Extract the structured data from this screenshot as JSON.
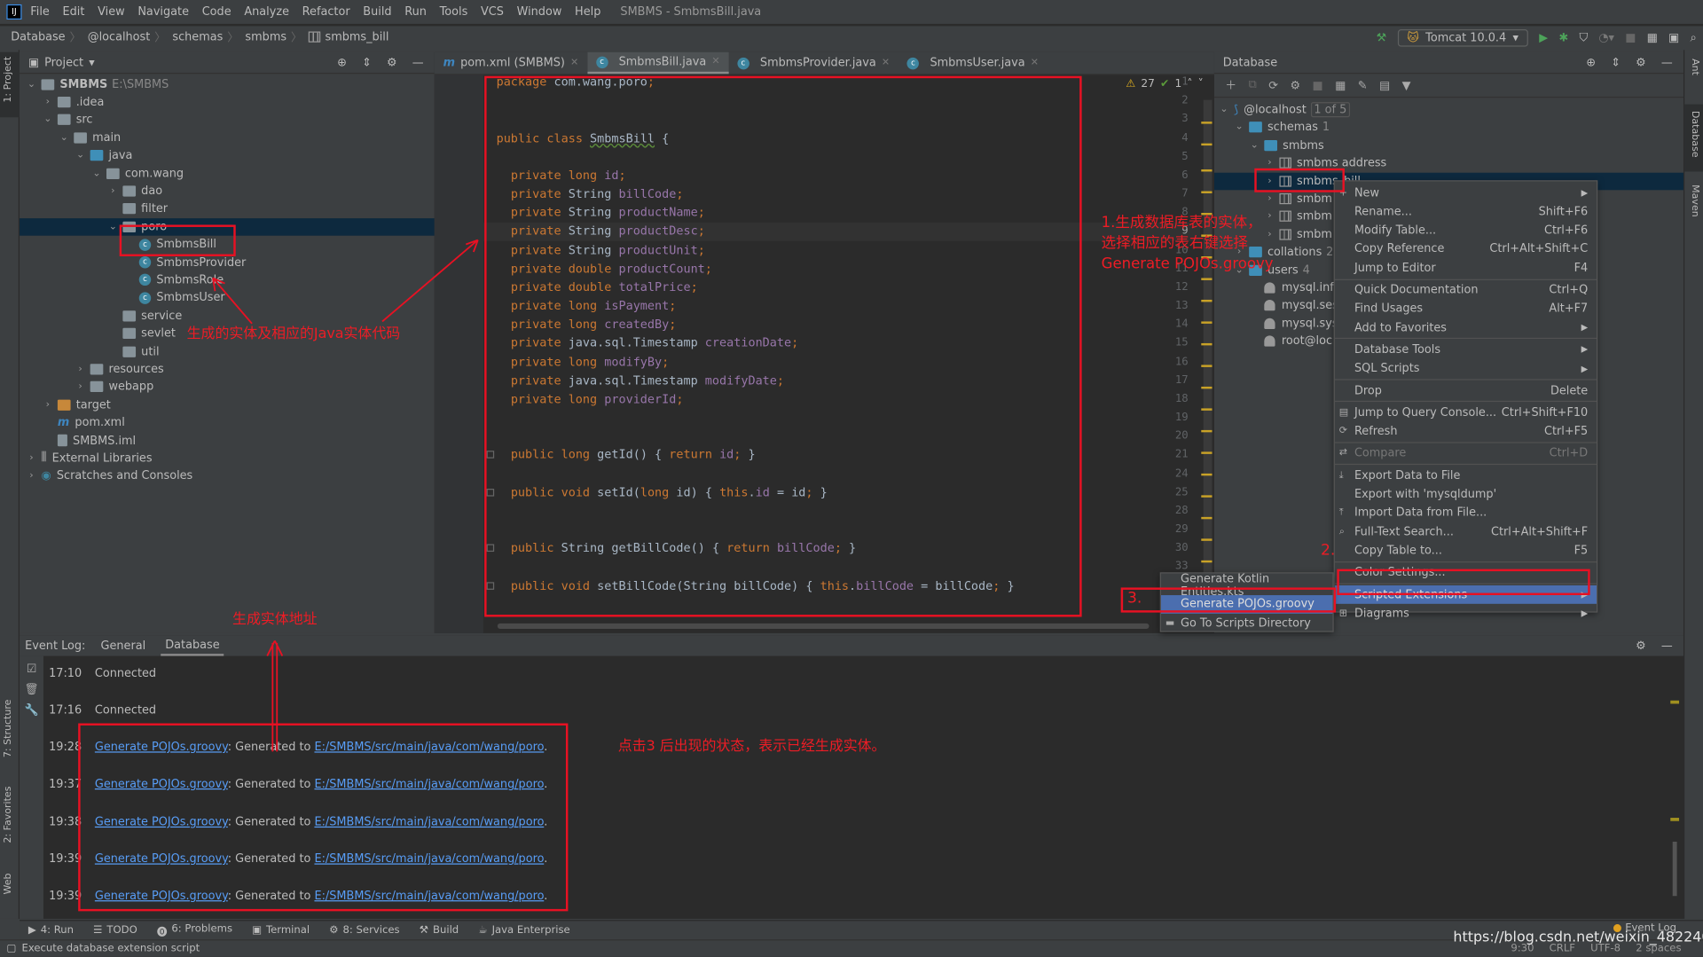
{
  "menubar": {
    "items": [
      "File",
      "Edit",
      "View",
      "Navigate",
      "Code",
      "Analyze",
      "Refactor",
      "Build",
      "Run",
      "Tools",
      "VCS",
      "Window",
      "Help"
    ],
    "title": "SMBMS - SmbmsBill.java"
  },
  "breadcrumb": [
    "Database",
    "@localhost",
    "schemas",
    "smbms",
    "smbms_bill"
  ],
  "run_config": "Tomcat 10.0.4",
  "left_strip": [
    "1: Project",
    "7: Structure",
    "2: Favorites",
    "Web"
  ],
  "right_strip": [
    "Ant",
    "Database",
    "Maven"
  ],
  "project": {
    "title": "Project",
    "tree": [
      {
        "label": "SMBMS",
        "extra": "E:\\SMBMS",
        "depth": 0,
        "open": true,
        "icon": "module"
      },
      {
        "label": ".idea",
        "depth": 1,
        "open": false,
        "icon": "folder"
      },
      {
        "label": "src",
        "depth": 1,
        "open": true,
        "icon": "folder"
      },
      {
        "label": "main",
        "depth": 2,
        "open": true,
        "icon": "folder"
      },
      {
        "label": "java",
        "depth": 3,
        "open": true,
        "icon": "folder-blue"
      },
      {
        "label": "com.wang",
        "depth": 4,
        "open": true,
        "icon": "folder"
      },
      {
        "label": "dao",
        "depth": 5,
        "open": false,
        "icon": "folder"
      },
      {
        "label": "filter",
        "depth": 5,
        "icon": "folder"
      },
      {
        "label": "poro",
        "depth": 5,
        "open": true,
        "icon": "folder",
        "selected": true
      },
      {
        "label": "SmbmsBill",
        "depth": 6,
        "icon": "class"
      },
      {
        "label": "SmbmsProvider",
        "depth": 6,
        "icon": "class"
      },
      {
        "label": "SmbmsRole",
        "depth": 6,
        "icon": "class"
      },
      {
        "label": "SmbmsUser",
        "depth": 6,
        "icon": "class"
      },
      {
        "label": "service",
        "depth": 5,
        "icon": "folder"
      },
      {
        "label": "sevlet",
        "depth": 5,
        "icon": "folder"
      },
      {
        "label": "util",
        "depth": 5,
        "icon": "folder"
      },
      {
        "label": "resources",
        "depth": 3,
        "open": false,
        "icon": "folder"
      },
      {
        "label": "webapp",
        "depth": 3,
        "open": false,
        "icon": "folder"
      },
      {
        "label": "target",
        "depth": 1,
        "open": false,
        "icon": "folder-orange"
      },
      {
        "label": "pom.xml",
        "depth": 1,
        "icon": "maven"
      },
      {
        "label": "SMBMS.iml",
        "depth": 1,
        "icon": "file"
      },
      {
        "label": "External Libraries",
        "depth": 0,
        "open": false,
        "icon": "library"
      },
      {
        "label": "Scratches and Consoles",
        "depth": 0,
        "open": false,
        "icon": "scratch"
      }
    ]
  },
  "editor": {
    "tabs": [
      {
        "label": "pom.xml (SMBMS)",
        "icon": "maven"
      },
      {
        "label": "SmbmsBill.java",
        "icon": "class",
        "active": true
      },
      {
        "label": "SmbmsProvider.java",
        "icon": "class"
      },
      {
        "label": "SmbmsUser.java",
        "icon": "class"
      }
    ],
    "warnings": "27",
    "ok": "1",
    "current_line": 9,
    "lines": [
      {
        "n": "1",
        "t": "package com.wang.poro;"
      },
      {
        "n": "2",
        "t": ""
      },
      {
        "n": "3",
        "t": ""
      },
      {
        "n": "4",
        "t": "public class SmbmsBill {"
      },
      {
        "n": "5",
        "t": ""
      },
      {
        "n": "6",
        "t": "  private long id;"
      },
      {
        "n": "7",
        "t": "  private String billCode;"
      },
      {
        "n": "8",
        "t": "  private String productName;"
      },
      {
        "n": "9",
        "t": "  private String productDesc;"
      },
      {
        "n": "10",
        "t": "  private String productUnit;"
      },
      {
        "n": "11",
        "t": "  private double productCount;"
      },
      {
        "n": "12",
        "t": "  private double totalPrice;"
      },
      {
        "n": "13",
        "t": "  private long isPayment;"
      },
      {
        "n": "14",
        "t": "  private long createdBy;"
      },
      {
        "n": "15",
        "t": "  private java.sql.Timestamp creationDate;"
      },
      {
        "n": "16",
        "t": "  private long modifyBy;"
      },
      {
        "n": "17",
        "t": "  private java.sql.Timestamp modifyDate;"
      },
      {
        "n": "18",
        "t": "  private long providerId;"
      },
      {
        "n": "19",
        "t": ""
      },
      {
        "n": "20",
        "t": ""
      },
      {
        "n": "21",
        "t": "  public long getId() { return id; }"
      },
      {
        "n": "24",
        "t": ""
      },
      {
        "n": "25",
        "t": "  public void setId(long id) { this.id = id; }"
      },
      {
        "n": "28",
        "t": ""
      },
      {
        "n": "29",
        "t": ""
      },
      {
        "n": "30",
        "t": "  public String getBillCode() { return billCode; }"
      },
      {
        "n": "33",
        "t": ""
      },
      {
        "n": "34",
        "t": "  public void setBillCode(String billCode) { this.billCode = billCode; }"
      },
      {
        "n": "37",
        "t": ""
      },
      {
        "n": "38",
        "t": ""
      }
    ]
  },
  "database": {
    "title": "Database",
    "tree": [
      {
        "label": "@localhost",
        "extra": "1 of 5",
        "depth": 0,
        "open": true,
        "icon": "datasource"
      },
      {
        "label": "schemas",
        "extra": "1",
        "depth": 1,
        "open": true,
        "icon": "folder"
      },
      {
        "label": "smbms",
        "depth": 2,
        "open": true,
        "icon": "schema"
      },
      {
        "label": "smbms address",
        "depth": 3,
        "open": false,
        "icon": "table"
      },
      {
        "label": "smbms_bill",
        "depth": 3,
        "open": false,
        "icon": "table",
        "selected": true
      },
      {
        "label": "smbm",
        "depth": 3,
        "open": false,
        "icon": "table"
      },
      {
        "label": "smbm",
        "depth": 3,
        "open": false,
        "icon": "table"
      },
      {
        "label": "smbm",
        "depth": 3,
        "open": false,
        "icon": "table"
      },
      {
        "label": "collations",
        "extra": "27",
        "depth": 1,
        "open": false,
        "icon": "folder"
      },
      {
        "label": "users",
        "extra": "4",
        "depth": 1,
        "open": true,
        "icon": "folder"
      },
      {
        "label": "mysql.info",
        "depth": 2,
        "icon": "user"
      },
      {
        "label": "mysql.ses",
        "depth": 2,
        "icon": "user"
      },
      {
        "label": "mysql.sys",
        "depth": 2,
        "icon": "user"
      },
      {
        "label": "root@loc",
        "depth": 2,
        "icon": "user"
      }
    ]
  },
  "context_menu": [
    {
      "label": "New",
      "sub": true,
      "icon": "plus"
    },
    {
      "label": "Rename...",
      "shortcut": "Shift+F6"
    },
    {
      "label": "Modify Table...",
      "shortcut": "Ctrl+F6"
    },
    {
      "label": "Copy Reference",
      "shortcut": "Ctrl+Alt+Shift+C"
    },
    {
      "label": "Jump to Editor",
      "shortcut": "F4"
    },
    {
      "sep": true
    },
    {
      "label": "Quick Documentation",
      "shortcut": "Ctrl+Q"
    },
    {
      "label": "Find Usages",
      "shortcut": "Alt+F7"
    },
    {
      "label": "Add to Favorites",
      "sub": true
    },
    {
      "sep": true
    },
    {
      "label": "Database Tools",
      "sub": true
    },
    {
      "label": "SQL Scripts",
      "sub": true
    },
    {
      "sep": true
    },
    {
      "label": "Drop",
      "shortcut": "Delete"
    },
    {
      "sep": true
    },
    {
      "label": "Jump to Query Console...",
      "shortcut": "Ctrl+Shift+F10",
      "icon": "console"
    },
    {
      "label": "Refresh",
      "shortcut": "Ctrl+F5",
      "icon": "refresh"
    },
    {
      "sep": true
    },
    {
      "label": "Compare",
      "shortcut": "Ctrl+D",
      "disabled": true,
      "icon": "compare"
    },
    {
      "sep": true
    },
    {
      "label": "Export Data to File",
      "icon": "download"
    },
    {
      "label": "Export with 'mysqldump'"
    },
    {
      "label": "Import Data from File...",
      "icon": "upload"
    },
    {
      "label": "Full-Text Search...",
      "shortcut": "Ctrl+Alt+Shift+F",
      "icon": "search"
    },
    {
      "label": "Copy Table to...",
      "shortcut": "F5"
    },
    {
      "sep": true
    },
    {
      "label": "Color Settings..."
    },
    {
      "sep": true
    },
    {
      "label": "Scripted Extensions",
      "sub": true,
      "highlighted": true
    },
    {
      "label": "Diagrams",
      "sub": true,
      "icon": "diagram"
    }
  ],
  "submenu": [
    {
      "label": "Generate Kotlin Entities.kts"
    },
    {
      "label": "Generate POJOs.groovy",
      "highlighted": true
    },
    {
      "label": "Go To Scripts Directory",
      "icon": "folder"
    }
  ],
  "event_log": {
    "title": "Event Log:",
    "tabs": [
      "General",
      "Database"
    ],
    "active_tab": "Database",
    "entries": [
      {
        "time": "17:10",
        "text": "Connected"
      },
      {
        "time": "17:16",
        "text": "Connected"
      },
      {
        "time": "19:28",
        "link": "Generate POJOs.groovy",
        "text": ": Generated to ",
        "path": "E:/SMBMS/src/main/java/com/wang/poro",
        "end": "."
      },
      {
        "time": "19:37",
        "link": "Generate POJOs.groovy",
        "text": ": Generated to ",
        "path": "E:/SMBMS/src/main/java/com/wang/poro",
        "end": "."
      },
      {
        "time": "19:38",
        "link": "Generate POJOs.groovy",
        "text": ": Generated to ",
        "path": "E:/SMBMS/src/main/java/com/wang/poro",
        "end": "."
      },
      {
        "time": "19:39",
        "link": "Generate POJOs.groovy",
        "text": ": Generated to ",
        "path": "E:/SMBMS/src/main/java/com/wang/poro",
        "end": "."
      },
      {
        "time": "19:39",
        "link": "Generate POJOs.groovy",
        "text": ": Generated to ",
        "path": "E:/SMBMS/src/main/java/com/wang/poro",
        "end": "."
      }
    ]
  },
  "bottom_tools": [
    "4: Run",
    "TODO",
    "6: Problems",
    "Terminal",
    "8: Services",
    "Build",
    "Java Enterprise"
  ],
  "event_log_button": "Event Log",
  "status": {
    "message": "Execute database extension script",
    "position": "9:30",
    "line_sep": "CRLF",
    "encoding": "UTF-8",
    "indent": "2 spaces"
  },
  "watermark": "https://blog.csdn.net/weixin_48224061",
  "annotations": {
    "step1": [
      "1.生成数据库表的实体，",
      "选择相应的表右键选择",
      "Generate POJOs.groovy"
    ],
    "step2": "2.",
    "step3": "3.",
    "entity_code": "生成的实体及相应的Java实体代码",
    "entity_path": "生成实体地址",
    "after_click": "点击3 后出现的状态，表示已经生成实体。",
    "color": "#e81123"
  },
  "colors": {
    "keyword": "#cc7832",
    "field": "#9876aa",
    "text": "#a9b7c6",
    "selection": "#4b6eaf",
    "link": "#589df6"
  }
}
